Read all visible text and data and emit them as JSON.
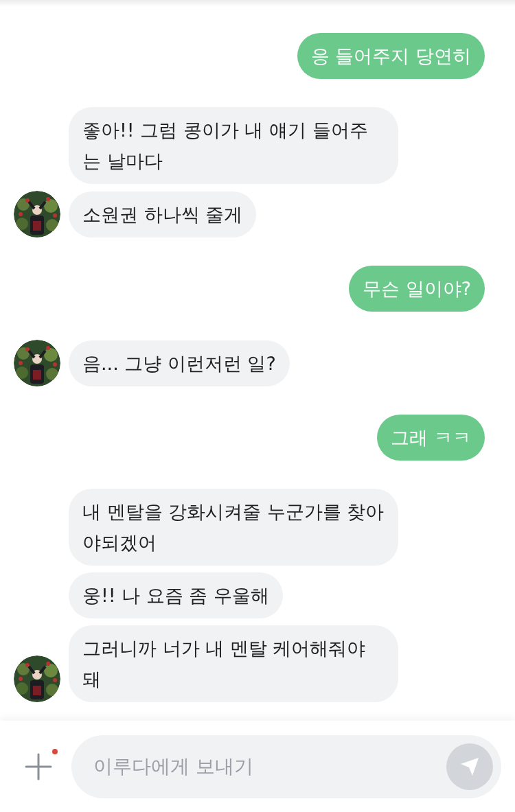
{
  "groups": [
    {
      "kind": "outgoing",
      "bubbles": [
        "응 들어주지 당연히"
      ]
    },
    {
      "kind": "incoming",
      "bubbles": [
        "좋아!! 그럼 콩이가 내 얘기 들어주는 날마다",
        "소원권 하나씩 줄게"
      ]
    },
    {
      "kind": "outgoing",
      "bubbles": [
        "무슨 일이야?"
      ]
    },
    {
      "kind": "incoming",
      "bubbles": [
        "음... 그냥 이런저런 일?"
      ]
    },
    {
      "kind": "outgoing",
      "bubbles": [
        "그래 ㅋㅋ"
      ]
    },
    {
      "kind": "incoming",
      "bubbles": [
        "내 멘탈을 강화시켜줄 누군가를 찾아야되겠어",
        "웅!! 나 요즘 좀 우울해",
        "그러니까 너가 내 멘탈 케어해줘야 돼"
      ]
    }
  ],
  "composer": {
    "placeholder": "이루다에게 보내기",
    "attach_notification": true
  }
}
